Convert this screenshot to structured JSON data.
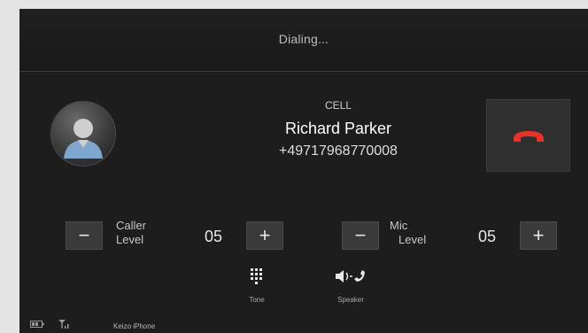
{
  "header": {
    "title": "Dialing..."
  },
  "caller": {
    "type": "CELL",
    "name": "Richard Parker",
    "number": "+49717968770008"
  },
  "hangup": {
    "icon": "hang-up-icon",
    "color": "#e8322a"
  },
  "caller_level": {
    "label_line1": "Caller",
    "label_line2": "Level",
    "value": "05",
    "minus": "−",
    "plus": "+"
  },
  "mic_level": {
    "label_line1": "Mic",
    "label_line2": "Level",
    "value": "05",
    "minus": "−",
    "plus": "+"
  },
  "controls": [
    {
      "label": "Tone",
      "icon": "keypad-icon"
    },
    {
      "label": "Speaker",
      "icon": "speaker-phone-icon"
    }
  ],
  "status": {
    "device_name": "Keizo iPhone",
    "icons": [
      "battery-icon",
      "signal-icon"
    ]
  }
}
